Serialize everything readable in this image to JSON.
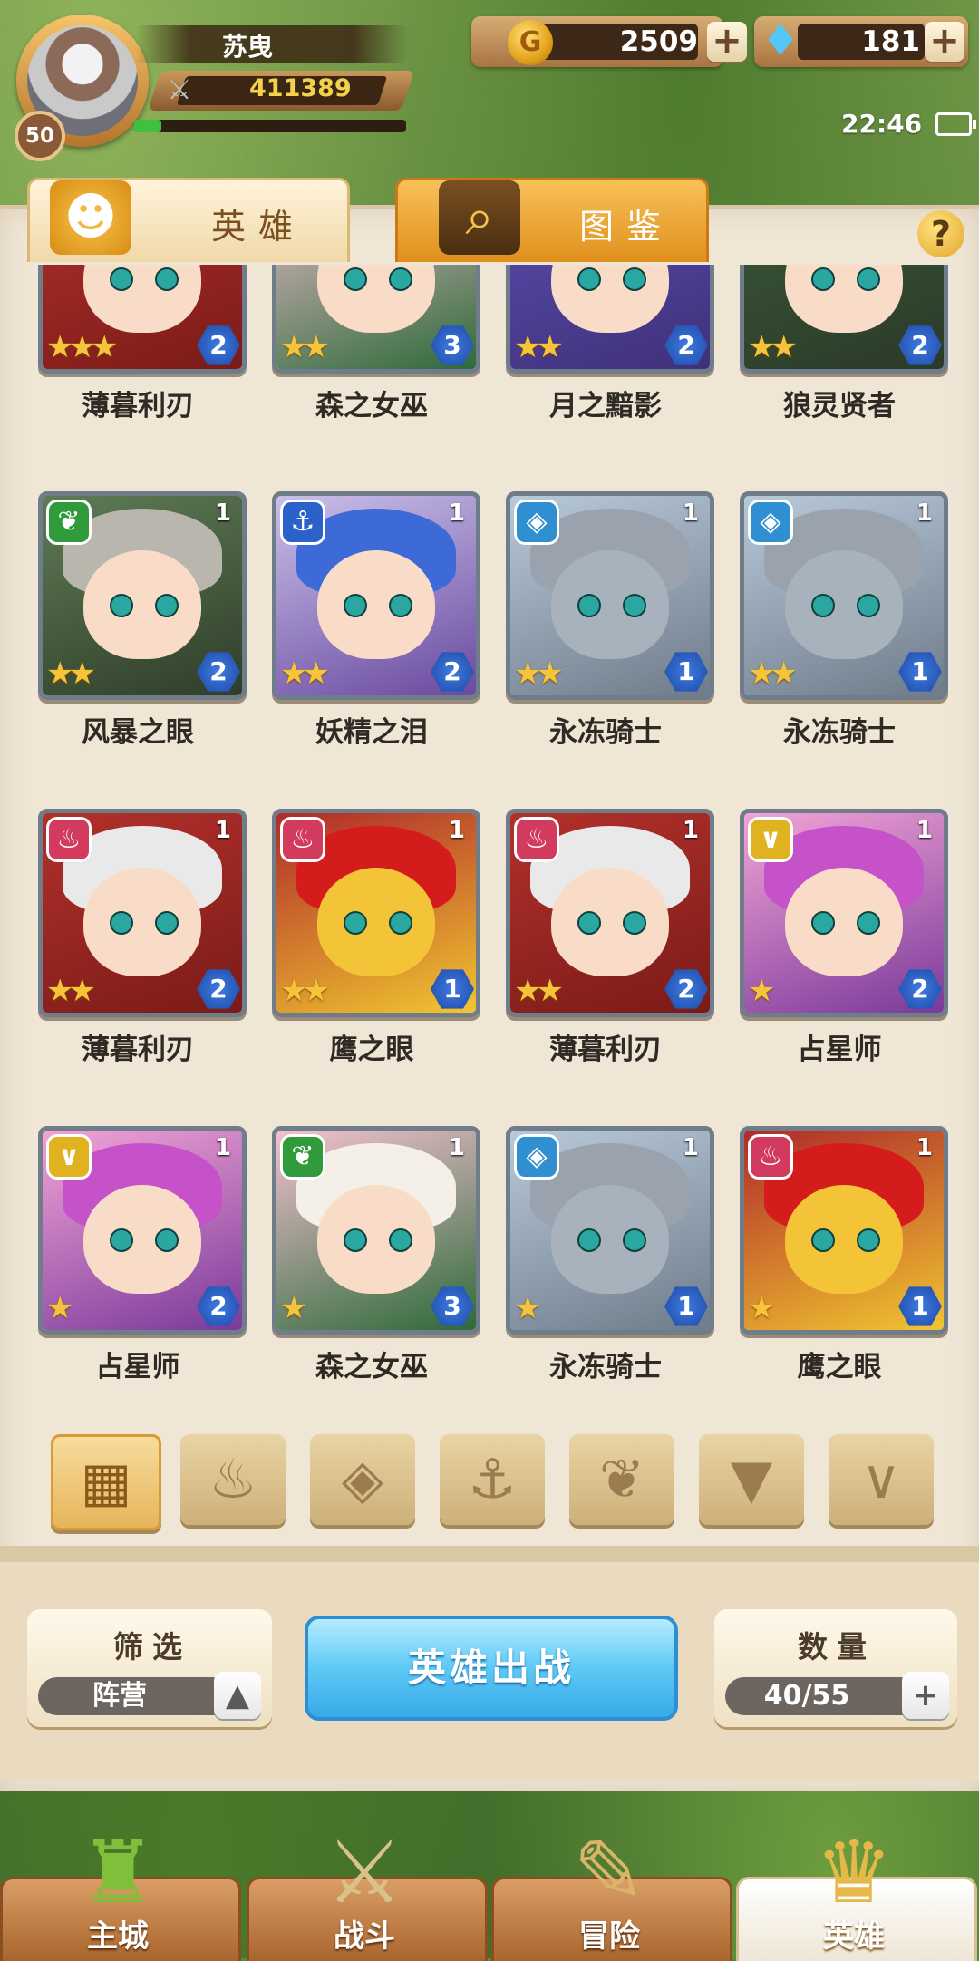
{
  "player": {
    "name": "苏曳",
    "level": "50",
    "power": "411389",
    "exp_fraction": 0.1
  },
  "resources": {
    "gold": "2509",
    "gems": "181"
  },
  "status": {
    "time": "22:46"
  },
  "tabs": {
    "heroes": "英雄",
    "codex": "图鉴"
  },
  "help_icon": "?",
  "heroes": [
    {
      "name": "薄暮利刃",
      "element": "fire",
      "stars": 3,
      "grade": "2",
      "rank": "",
      "art": "red-hood"
    },
    {
      "name": "森之女巫",
      "element": "forest",
      "stars": 2,
      "grade": "3",
      "rank": "",
      "art": "elf"
    },
    {
      "name": "月之黯影",
      "element": "anchor",
      "stars": 2,
      "grade": "2",
      "rank": "",
      "art": "blonde"
    },
    {
      "name": "狼灵贤者",
      "element": "wild",
      "stars": 2,
      "grade": "2",
      "rank": "",
      "art": "wolf"
    },
    {
      "name": "风暴之眼",
      "element": "forest",
      "stars": 2,
      "grade": "2",
      "rank": "1",
      "art": "grey"
    },
    {
      "name": "妖精之泪",
      "element": "anchor",
      "stars": 2,
      "grade": "2",
      "rank": "1",
      "art": "blue"
    },
    {
      "name": "永冻骑士",
      "element": "ice",
      "stars": 2,
      "grade": "1",
      "rank": "1",
      "art": "knight"
    },
    {
      "name": "永冻骑士",
      "element": "ice",
      "stars": 2,
      "grade": "1",
      "rank": "1",
      "art": "knight"
    },
    {
      "name": "薄暮利刃",
      "element": "fire",
      "stars": 2,
      "grade": "2",
      "rank": "1",
      "art": "red-hood"
    },
    {
      "name": "鹰之眼",
      "element": "fire",
      "stars": 2,
      "grade": "1",
      "rank": "1",
      "art": "eagle"
    },
    {
      "name": "薄暮利刃",
      "element": "fire",
      "stars": 2,
      "grade": "2",
      "rank": "1",
      "art": "red-hood"
    },
    {
      "name": "占星师",
      "element": "light",
      "stars": 1,
      "grade": "2",
      "rank": "1",
      "art": "witch"
    },
    {
      "name": "占星师",
      "element": "light",
      "stars": 1,
      "grade": "2",
      "rank": "1",
      "art": "witch"
    },
    {
      "name": "森之女巫",
      "element": "forest",
      "stars": 1,
      "grade": "3",
      "rank": "1",
      "art": "elf"
    },
    {
      "name": "永冻骑士",
      "element": "ice",
      "stars": 1,
      "grade": "1",
      "rank": "1",
      "art": "knight"
    },
    {
      "name": "鹰之眼",
      "element": "fire",
      "stars": 1,
      "grade": "1",
      "rank": "1",
      "art": "eagle"
    }
  ],
  "element_filters": [
    {
      "icon": "grid-icon",
      "glyph": "▦"
    },
    {
      "icon": "fire-faction-icon",
      "glyph": "♨"
    },
    {
      "icon": "ice-faction-icon",
      "glyph": "◈"
    },
    {
      "icon": "anchor-faction-icon",
      "glyph": "⚓"
    },
    {
      "icon": "forest-faction-icon",
      "glyph": "❦"
    },
    {
      "icon": "shadow-faction-icon",
      "glyph": "▼"
    },
    {
      "icon": "light-faction-icon",
      "glyph": "∨"
    }
  ],
  "filter": {
    "label": "筛选",
    "value": "阵营"
  },
  "deploy_label": "英雄出战",
  "count": {
    "label": "数量",
    "value": "40/55"
  },
  "nav": [
    {
      "label": "主城",
      "icon": "castle-icon",
      "active": false
    },
    {
      "label": "战斗",
      "icon": "crossed-swords-icon",
      "active": false
    },
    {
      "label": "冒险",
      "icon": "scroll-map-icon",
      "active": false
    },
    {
      "label": "英雄",
      "icon": "helmet-icon",
      "active": true
    }
  ],
  "colors": {
    "fire": "#d23a5e",
    "forest": "#2f9b3b",
    "anchor": "#2a62c9",
    "ice": "#2f8fd0",
    "light": "#e0b21f",
    "wild": "#8a6a3a"
  }
}
